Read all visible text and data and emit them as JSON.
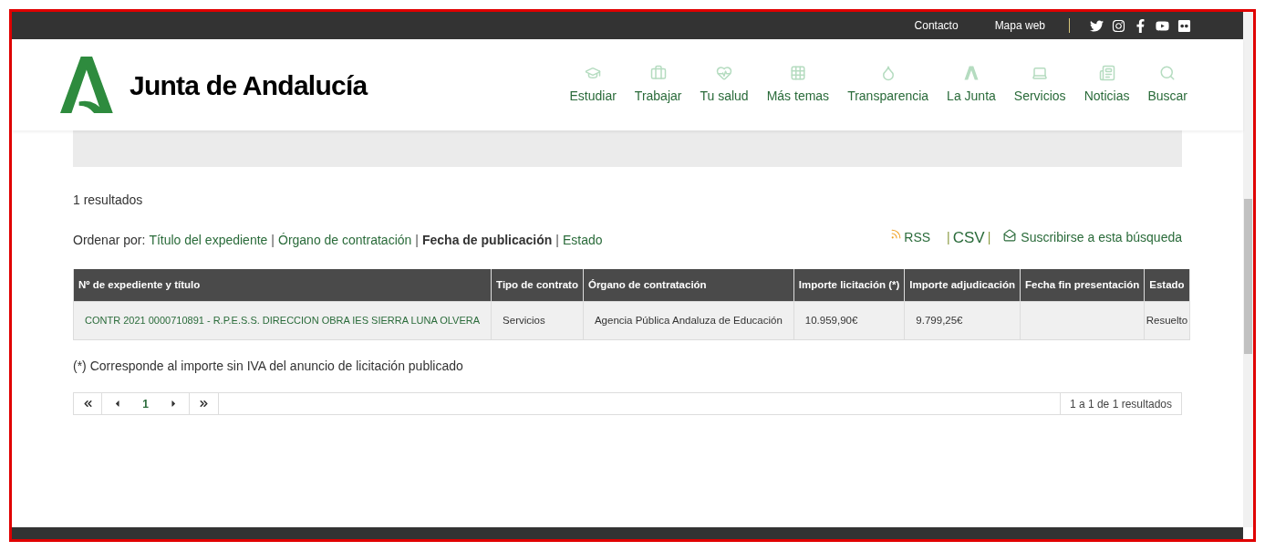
{
  "top_bar": {
    "links": [
      "Contacto",
      "Mapa web"
    ]
  },
  "header": {
    "brand": "Junta de Andalucía",
    "nav": [
      "Estudiar",
      "Trabajar",
      "Tu salud",
      "Más temas",
      "Transparencia",
      "La Junta",
      "Servicios",
      "Noticias",
      "Buscar"
    ]
  },
  "results": {
    "count": "1 resultados",
    "sort": {
      "label": "Ordenar por:",
      "separators": [
        "|",
        "|",
        "|"
      ],
      "options": [
        {
          "label": "Título del expediente",
          "selected": false
        },
        {
          "label": "Órgano de contratación",
          "selected": false
        },
        {
          "label": "Fecha de publicación",
          "selected": true
        },
        {
          "label": "Estado",
          "selected": false
        }
      ]
    },
    "exports": {
      "rss": "RSS",
      "separator_before_csv": "|",
      "csv": "CSV",
      "separator_after_csv": "|",
      "subscribe": "Suscribirse a esta búsqueda"
    }
  },
  "table": {
    "columns": [
      "Nº de expediente y título",
      "Tipo de contrato",
      "Órgano de contratación",
      "Importe licitación (*)",
      "Importe adjudicación",
      "Fecha fin presentación",
      "Estado"
    ],
    "rows": [
      [
        "CONTR 2021 0000710891 - R.P.E.S.S. DIRECCION OBRA IES SIERRA LUNA OLVERA",
        "Servicios",
        "Agencia Pública Andaluza de Educación",
        "10.959,90€",
        "9.799,25€",
        "",
        "Resuelto"
      ]
    ]
  },
  "footnote": "(*) Corresponde al importe sin IVA del anuncio de licitación publicado",
  "pagination": {
    "page": "1",
    "summary": "1 a 1 de 1 resultados"
  }
}
